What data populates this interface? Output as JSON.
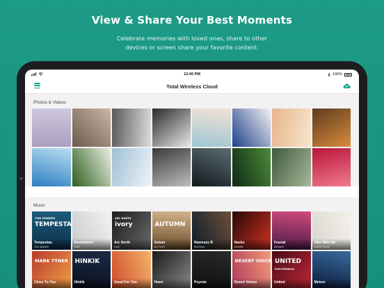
{
  "promo": {
    "title": "View & Share Your Best Moments",
    "subtitle_line1": "Celebrate memories with loved ones, share to other",
    "subtitle_line2": "devices or screen share your favorite content."
  },
  "status_bar": {
    "time": "12:00 PM",
    "battery": "100%"
  },
  "nav": {
    "title": "Total Wireless Cloud"
  },
  "colors": {
    "accent": "#1a9f86",
    "background": "#169580"
  },
  "photos": {
    "label": "Photos & Videos",
    "tiles": [
      {
        "name": "photo-lavender-field",
        "c1": "#a99ec0",
        "c2": "#cfc7dc"
      },
      {
        "name": "photo-street-shoppers",
        "c1": "#6d5a4c",
        "c2": "#c7b7a3"
      },
      {
        "name": "photo-white-alpaca",
        "c1": "#5a5a5a",
        "c2": "#dcdcdc"
      },
      {
        "name": "photo-silhouette-tree",
        "c1": "#2a2a2a",
        "c2": "#e8e8e8"
      },
      {
        "name": "photo-beach-walk",
        "c1": "#9ec6d4",
        "c2": "#f2e2d3"
      },
      {
        "name": "photo-blue-pattern",
        "c1": "#1e3f8a",
        "c2": "#f2f2f2"
      },
      {
        "name": "photo-sunset-pier",
        "c1": "#e8b48a",
        "c2": "#f6e6cf"
      },
      {
        "name": "photo-tiger",
        "c1": "#5d3b1f",
        "c2": "#d98b3b"
      },
      {
        "name": "photo-ocean-cliffs",
        "c1": "#2d7fc0",
        "c2": "#b9def2"
      },
      {
        "name": "photo-white-flower",
        "c1": "#2f5e1e",
        "c2": "#eaf0e2"
      },
      {
        "name": "photo-glass-building",
        "c1": "#9fbfd6",
        "c2": "#eef4f8"
      },
      {
        "name": "photo-city-street",
        "c1": "#3a3a3a",
        "c2": "#bdbdbd"
      },
      {
        "name": "photo-dark-window",
        "c1": "#121a1e",
        "c2": "#5c6c70"
      },
      {
        "name": "photo-green-plants",
        "c1": "#0f2a14",
        "c2": "#4a8a3a"
      },
      {
        "name": "photo-white-heron",
        "c1": "#3f5a3a",
        "c2": "#a7b79a"
      },
      {
        "name": "photo-pink-flower",
        "c1": "#b8163a",
        "c2": "#f07a8e"
      }
    ]
  },
  "music": {
    "label": "Music",
    "tiles": [
      {
        "name": "album-tempestas",
        "title": "Tempestas",
        "artist": "Tom Spander",
        "art": "TEMPESTAS",
        "art_small": "TOM SPANDER",
        "c1": "#0d2f4a",
        "c2": "#1a5c7c"
      },
      {
        "name": "album-destination",
        "title": "Destination",
        "artist": "MBB",
        "art": "",
        "art_small": "",
        "c1": "#c8c8c8",
        "c2": "#f3f3f3"
      },
      {
        "name": "album-arc-north",
        "title": "Arc North",
        "artist": "Ivory",
        "art": "ivory",
        "art_small": "ARC NORTH",
        "c1": "#1c1c1c",
        "c2": "#6a6a6a"
      },
      {
        "name": "album-autum",
        "title": "Autum",
        "artist": "Ian Ferrer",
        "art": "AUTUMN",
        "art_small": "",
        "c1": "#6b4a2a",
        "c2": "#d0b48a"
      },
      {
        "name": "album-rameses-b",
        "title": "Rameses B",
        "artist": "Bad Beat",
        "art": "",
        "art_small": "",
        "c1": "#0a1c2a",
        "c2": "#6d4f3a"
      },
      {
        "name": "album-nasko",
        "title": "Nasko",
        "artist": "Definitie",
        "art": "",
        "art_small": "",
        "c1": "#260a0a",
        "c2": "#d03020"
      },
      {
        "name": "album-fractal",
        "title": "Fractal",
        "artist": "Mendeni",
        "art": "",
        "art_small": "",
        "c1": "#4a1a4a",
        "c2": "#d04a7a"
      },
      {
        "name": "album-vibe-with-me",
        "title": "Vibe With Me",
        "artist": "Joakim Karud",
        "art": "",
        "art_small": "",
        "c1": "#d8d6cf",
        "c2": "#f3f1ea"
      },
      {
        "name": "album-close-to-you",
        "title": "Close To You",
        "artist": "",
        "art": "MARK TYNER",
        "art_small": "",
        "c1": "#b83a2a",
        "c2": "#f0a14a"
      },
      {
        "name": "album-hinkik",
        "title": "Hinkik",
        "artist": "",
        "art": "HINKIK",
        "art_small": "",
        "c1": "#0a1020",
        "c2": "#1c2a44"
      },
      {
        "name": "album-good-for-you",
        "title": "Good For You",
        "artist": "",
        "art": "",
        "art_small": "",
        "c1": "#d04a2a",
        "c2": "#f4b36a"
      },
      {
        "name": "album-heart",
        "title": "Heart",
        "artist": "",
        "art": "",
        "art_small": "",
        "c1": "#1a1a1a",
        "c2": "#8a8a8a"
      },
      {
        "name": "album-peyruis",
        "title": "Peyruis",
        "artist": "",
        "art": "",
        "art_small": "",
        "c1": "#0e0e0e",
        "c2": "#2a2a2a"
      },
      {
        "name": "album-desert-voices",
        "title": "Desert Voices",
        "artist": "",
        "art": "DESERT VOICES",
        "art_small": "",
        "c1": "#b03a5a",
        "c2": "#f09a7a"
      },
      {
        "name": "album-united",
        "title": "United",
        "artist": "",
        "art": "UNITED",
        "art_small": "ELECTRONICA",
        "c1": "#4a0a14",
        "c2": "#c02a3a"
      },
      {
        "name": "album-meteor",
        "title": "Meteor",
        "artist": "",
        "art": "",
        "art_small": "",
        "c1": "#0a1a3a",
        "c2": "#3a6aa0"
      }
    ]
  }
}
